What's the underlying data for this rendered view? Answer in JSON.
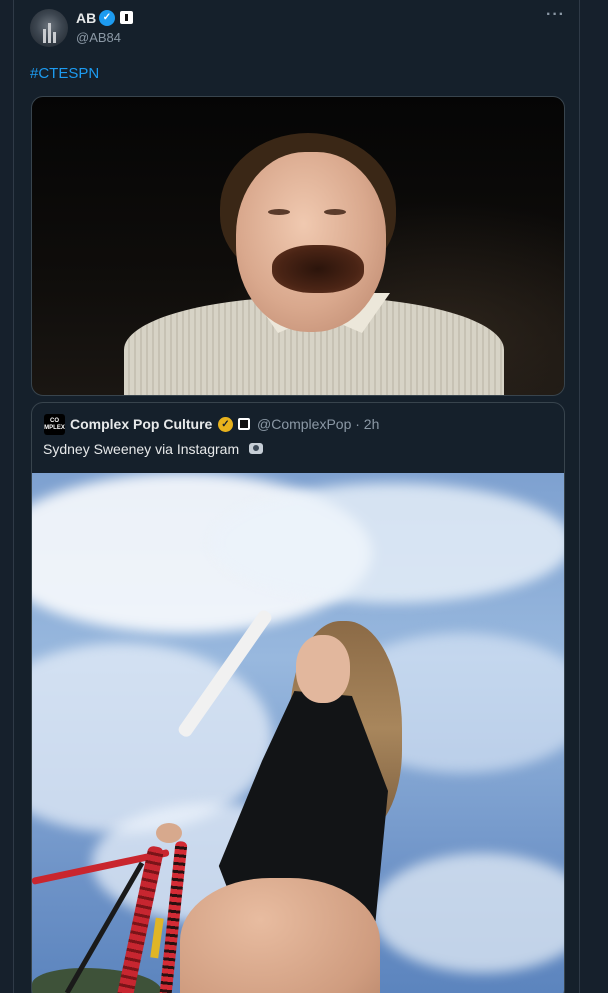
{
  "tweet": {
    "author_name": "AB",
    "author_handle": "@AB84",
    "hashtag": "#CTESPN",
    "more_label": "···"
  },
  "quoted_tweet": {
    "avatar_text": "CO MPLEX",
    "author_name": "Complex Pop Culture",
    "author_handle": "@ComplexPop · 2h",
    "text": "Sydney Sweeney via Instagram"
  },
  "icons": {
    "verified": "verified-check-icon",
    "quoted_verified": "gold-verified-check-icon",
    "more": "more-horizontal-icon",
    "camera": "camera-icon"
  },
  "colors": {
    "background": "#15202b",
    "link": "#1d9bf0",
    "secondary_text": "#8b98a5",
    "verified_blue": "#1d9bf0",
    "verified_gold": "#e8b21d"
  }
}
